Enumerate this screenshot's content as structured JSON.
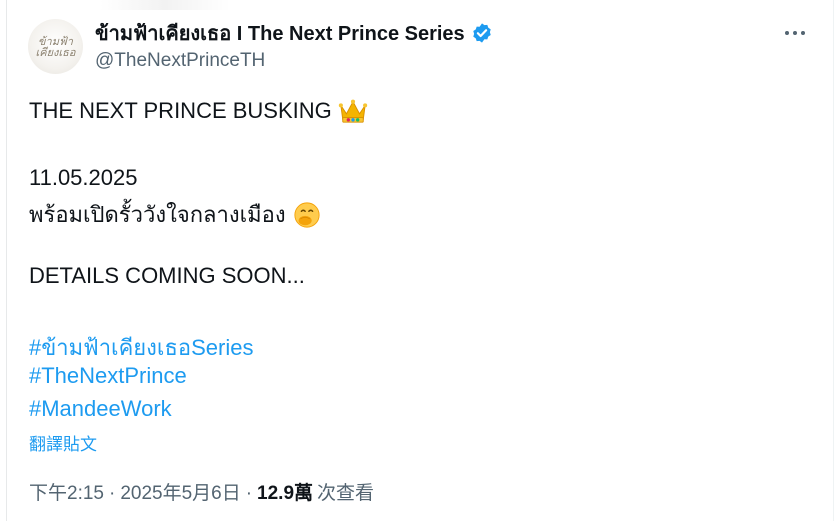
{
  "post": {
    "author": {
      "display_name": "ข้ามฟ้าเคียงเธอ I The Next Prince Series",
      "handle": "@TheNextPrinceTH",
      "avatar_text": "ข้ามฟ้า เคียงเธอ",
      "verified_icon": "verified-badge-icon",
      "verified_color": "#1d9bf0"
    },
    "more_icon": "more-horizontal-icon",
    "lines": {
      "line1": "THE NEXT PRINCE BUSKING",
      "line1_emoji": "crown-emoji",
      "line2": "11.05.2025",
      "line3": "พร้อมเปิดรั้ววังใจกลางเมือง",
      "line3_emoji": "face-with-hand-over-mouth-emoji",
      "line4": "DETAILS COMING SOON..."
    },
    "hashtags": [
      "#ข้ามฟ้าเคียงเธอSeries",
      "#TheNextPrince",
      "#MandeeWork"
    ],
    "translate_label": "翻譯貼文",
    "meta": {
      "time": "下午2:15",
      "separator": "·",
      "date": "2025年5月6日",
      "views_count": "12.9萬",
      "views_label": "次查看"
    },
    "colors": {
      "link": "#1d9bf0",
      "text": "#0f1419",
      "secondary": "#536471"
    }
  }
}
